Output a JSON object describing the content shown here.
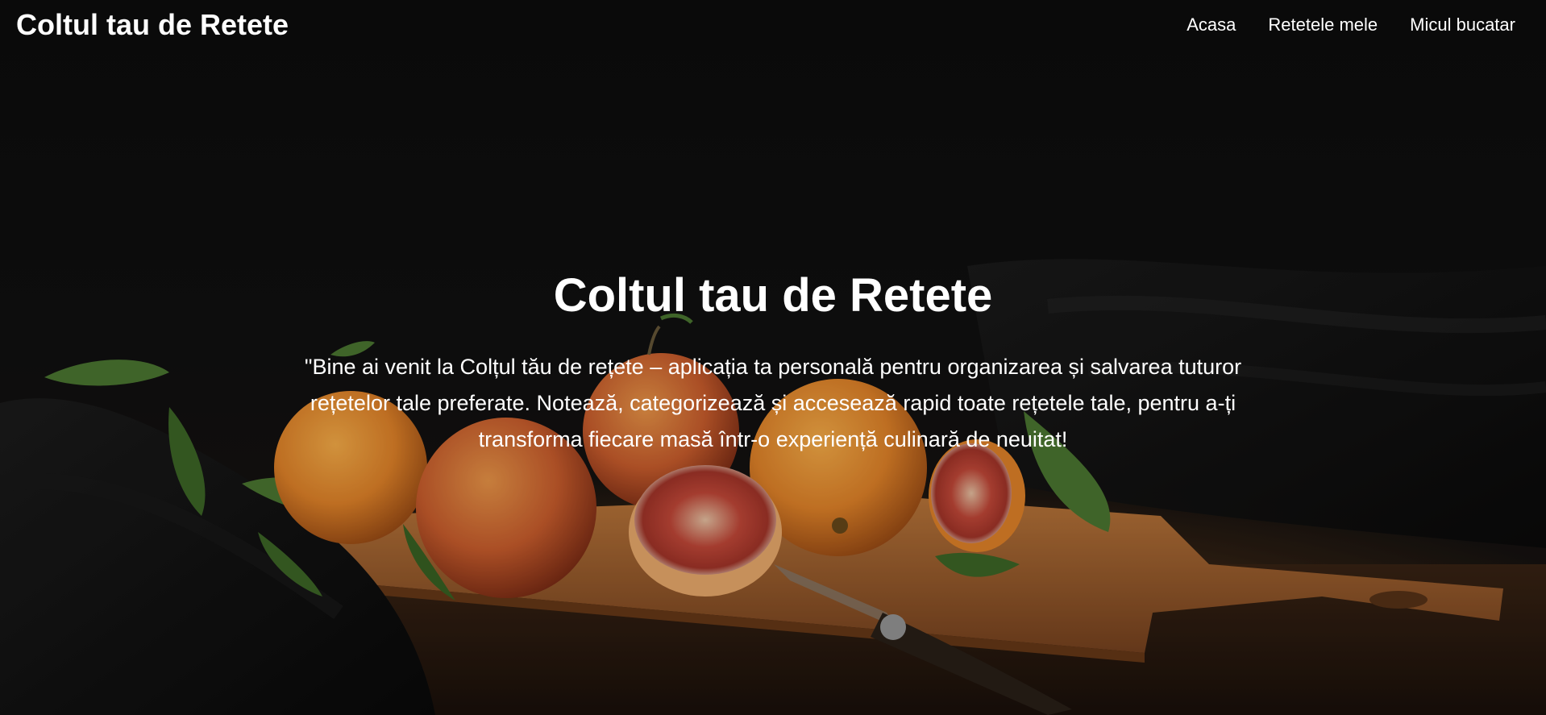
{
  "header": {
    "brand": "Coltul tau de Retete",
    "nav": [
      "Acasa",
      "Retetele mele",
      "Micul bucatar"
    ]
  },
  "hero": {
    "title": "Coltul tau de Retete",
    "text": "\"Bine ai venit la Colțul tău de rețete – aplicația ta personală pentru organizarea și salvarea tuturor rețetelor tale preferate. Notează, categorizează și accesează rapid toate rețetele tale, pentru a-ți transforma fiecare masă într-o experiență culinară de neuitat!",
    "image": "oranges-on-cutting-board"
  },
  "colors": {
    "background": "#0b0b0b",
    "text": "#ffffff",
    "orange": "#e8872a",
    "blood_orange": "#c0492a",
    "board": "#a0642e",
    "leaf": "#4d7a32"
  }
}
